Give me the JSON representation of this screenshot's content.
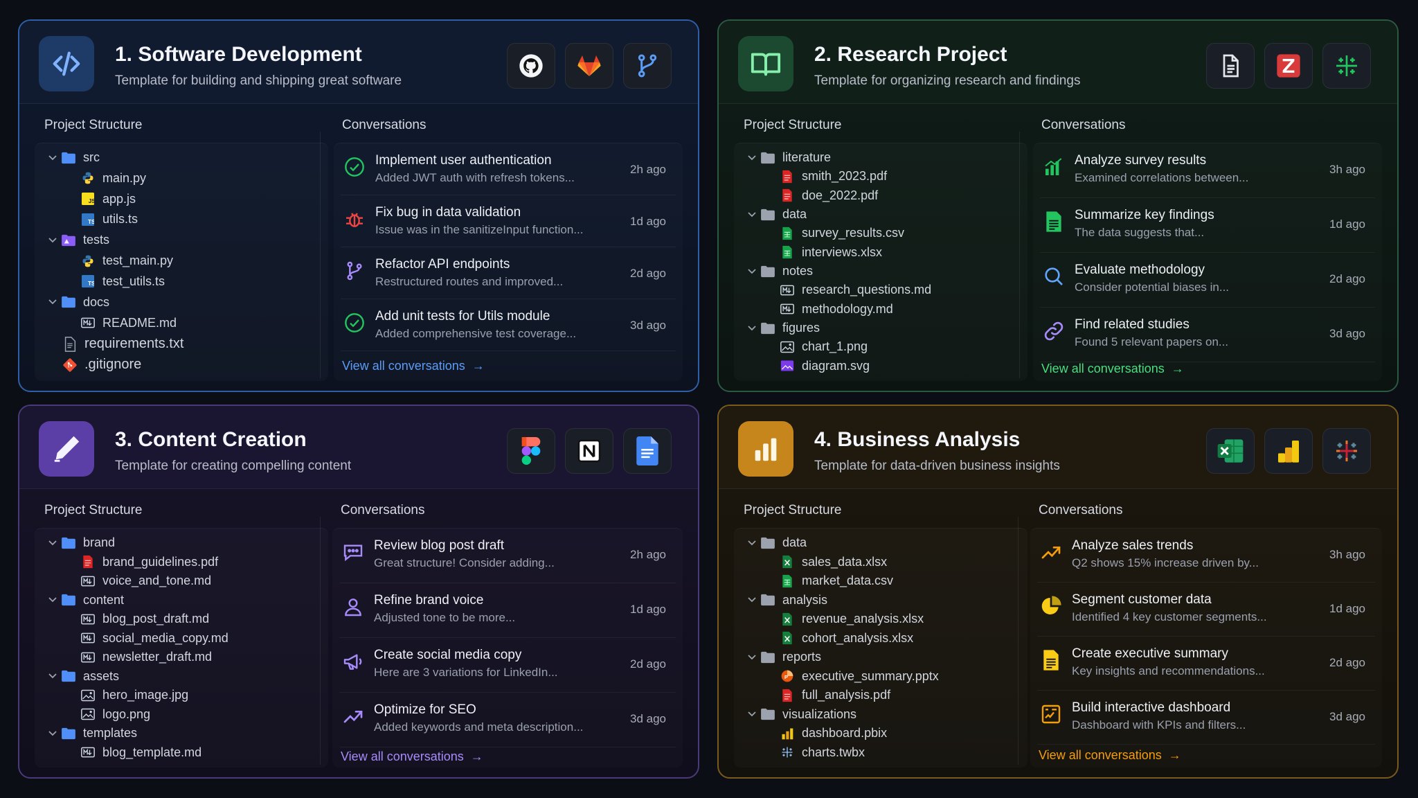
{
  "cards": [
    {
      "title": "1. Software Development",
      "subtitle": "Template for building and shipping great software",
      "accent": "#3b82f6",
      "tools": [
        "github-icon",
        "gitlab-icon",
        "git-branch-icon"
      ],
      "structure_label": "Project Structure",
      "conversations_label": "Conversations",
      "tree": [
        {
          "label": "src",
          "depth": 0,
          "type": "folder"
        },
        {
          "label": "main.py",
          "depth": 1,
          "type": "python"
        },
        {
          "label": "app.js",
          "depth": 1,
          "type": "js"
        },
        {
          "label": "utils.ts",
          "depth": 1,
          "type": "ts"
        },
        {
          "label": "tests",
          "depth": 0,
          "type": "test-folder"
        },
        {
          "label": "test_main.py",
          "depth": 1,
          "type": "python"
        },
        {
          "label": "test_utils.ts",
          "depth": 1,
          "type": "ts"
        },
        {
          "label": "docs",
          "depth": 0,
          "type": "folder"
        },
        {
          "label": "README.md",
          "depth": 1,
          "type": "md"
        },
        {
          "label": "requirements.txt",
          "depth": 0,
          "type": "txt"
        },
        {
          "label": ".gitignore",
          "depth": 0,
          "type": "git"
        }
      ],
      "conversations": [
        {
          "title": "Implement user authentication",
          "desc": "Added JWT auth with refresh tokens...",
          "ago": "2h ago",
          "icon": "check-circle-icon",
          "color": "#22c55e"
        },
        {
          "title": "Fix bug in data validation",
          "desc": "Issue was in the sanitizeInput function...",
          "ago": "1d ago",
          "icon": "bug-icon",
          "color": "#ef4444"
        },
        {
          "title": "Refactor API endpoints",
          "desc": "Restructured routes and improved...",
          "ago": "2d ago",
          "icon": "git-branch-icon",
          "color": "#a78bfa"
        },
        {
          "title": "Add unit tests for Utils module",
          "desc": "Added comprehensive test coverage...",
          "ago": "3d ago",
          "icon": "check-circle-icon",
          "color": "#22c55e"
        }
      ],
      "view_all": "View all conversations"
    },
    {
      "title": "2. Research Project",
      "subtitle": "Template for organizing research and findings",
      "accent": "#22c55e",
      "tools": [
        "document-icon",
        "zotero-icon",
        "grid-icon"
      ],
      "structure_label": "Project Structure",
      "conversations_label": "Conversations",
      "tree": [
        {
          "label": "literature",
          "depth": 0,
          "type": "folder-gray"
        },
        {
          "label": "smith_2023.pdf",
          "depth": 1,
          "type": "pdf"
        },
        {
          "label": "doe_2022.pdf",
          "depth": 1,
          "type": "pdf"
        },
        {
          "label": "data",
          "depth": 0,
          "type": "folder-gray"
        },
        {
          "label": "survey_results.csv",
          "depth": 1,
          "type": "csv"
        },
        {
          "label": "interviews.xlsx",
          "depth": 1,
          "type": "csv"
        },
        {
          "label": "notes",
          "depth": 0,
          "type": "folder-gray"
        },
        {
          "label": "research_questions.md",
          "depth": 1,
          "type": "md"
        },
        {
          "label": "methodology.md",
          "depth": 1,
          "type": "md"
        },
        {
          "label": "figures",
          "depth": 0,
          "type": "folder-gray"
        },
        {
          "label": "chart_1.png",
          "depth": 1,
          "type": "image"
        },
        {
          "label": "diagram.svg",
          "depth": 1,
          "type": "svg"
        }
      ],
      "conversations": [
        {
          "title": "Analyze survey results",
          "desc": "Examined correlations between...",
          "ago": "3h ago",
          "icon": "bar-chart-icon",
          "color": "#22c55e"
        },
        {
          "title": "Summarize key findings",
          "desc": "The data suggests that...",
          "ago": "1d ago",
          "icon": "document-icon",
          "color": "#22c55e"
        },
        {
          "title": "Evaluate methodology",
          "desc": "Consider potential biases in...",
          "ago": "2d ago",
          "icon": "search-icon",
          "color": "#60a5fa"
        },
        {
          "title": "Find related studies",
          "desc": "Found 5 relevant papers on...",
          "ago": "3d ago",
          "icon": "link-icon",
          "color": "#a78bfa"
        }
      ],
      "view_all": "View all conversations"
    },
    {
      "title": "3. Content Creation",
      "subtitle": "Template for creating compelling content",
      "accent": "#8b5cf6",
      "tools": [
        "figma-icon",
        "notion-icon",
        "google-docs-icon"
      ],
      "structure_label": "Project Structure",
      "conversations_label": "Conversations",
      "tree": [
        {
          "label": "brand",
          "depth": 0,
          "type": "folder"
        },
        {
          "label": "brand_guidelines.pdf",
          "depth": 1,
          "type": "pdf"
        },
        {
          "label": "voice_and_tone.md",
          "depth": 1,
          "type": "md"
        },
        {
          "label": "content",
          "depth": 0,
          "type": "folder"
        },
        {
          "label": "blog_post_draft.md",
          "depth": 1,
          "type": "md"
        },
        {
          "label": "social_media_copy.md",
          "depth": 1,
          "type": "md"
        },
        {
          "label": "newsletter_draft.md",
          "depth": 1,
          "type": "md"
        },
        {
          "label": "assets",
          "depth": 0,
          "type": "folder"
        },
        {
          "label": "hero_image.jpg",
          "depth": 1,
          "type": "image"
        },
        {
          "label": "logo.png",
          "depth": 1,
          "type": "image"
        },
        {
          "label": "templates",
          "depth": 0,
          "type": "folder"
        },
        {
          "label": "blog_template.md",
          "depth": 1,
          "type": "md"
        }
      ],
      "conversations": [
        {
          "title": "Review blog post draft",
          "desc": "Great structure! Consider adding...",
          "ago": "2h ago",
          "icon": "chat-bubble-icon",
          "color": "#a78bfa"
        },
        {
          "title": "Refine brand voice",
          "desc": "Adjusted tone to be more...",
          "ago": "1d ago",
          "icon": "user-icon",
          "color": "#a78bfa"
        },
        {
          "title": "Create social media copy",
          "desc": "Here are 3 variations for LinkedIn...",
          "ago": "2d ago",
          "icon": "megaphone-icon",
          "color": "#a78bfa"
        },
        {
          "title": "Optimize for SEO",
          "desc": "Added keywords and meta description...",
          "ago": "3d ago",
          "icon": "trend-up-icon",
          "color": "#a78bfa"
        }
      ],
      "view_all": "View all conversations"
    },
    {
      "title": "4. Business Analysis",
      "subtitle": "Template for data-driven business insights",
      "accent": "#f59e0b",
      "tools": [
        "excel-icon",
        "power-bi-icon",
        "tableau-icon"
      ],
      "structure_label": "Project Structure",
      "conversations_label": "Conversations",
      "tree": [
        {
          "label": "data",
          "depth": 0,
          "type": "folder-gray"
        },
        {
          "label": "sales_data.xlsx",
          "depth": 1,
          "type": "excel"
        },
        {
          "label": "market_data.csv",
          "depth": 1,
          "type": "csv"
        },
        {
          "label": "analysis",
          "depth": 0,
          "type": "folder-gray"
        },
        {
          "label": "revenue_analysis.xlsx",
          "depth": 1,
          "type": "excel"
        },
        {
          "label": "cohort_analysis.xlsx",
          "depth": 1,
          "type": "excel"
        },
        {
          "label": "reports",
          "depth": 0,
          "type": "folder-gray"
        },
        {
          "label": "executive_summary.pptx",
          "depth": 1,
          "type": "pptx"
        },
        {
          "label": "full_analysis.pdf",
          "depth": 1,
          "type": "pdf"
        },
        {
          "label": "visualizations",
          "depth": 0,
          "type": "folder-gray"
        },
        {
          "label": "dashboard.pbix",
          "depth": 1,
          "type": "pbix"
        },
        {
          "label": "charts.twbx",
          "depth": 1,
          "type": "twbx"
        }
      ],
      "conversations": [
        {
          "title": "Analyze sales trends",
          "desc": "Q2 shows 15% increase driven by...",
          "ago": "3h ago",
          "icon": "trend-up-icon",
          "color": "#f59e0b"
        },
        {
          "title": "Segment customer data",
          "desc": "Identified 4 key customer segments...",
          "ago": "1d ago",
          "icon": "pie-chart-icon",
          "color": "#facc15"
        },
        {
          "title": "Create executive summary",
          "desc": "Key insights and recommendations...",
          "ago": "2d ago",
          "icon": "document-icon",
          "color": "#facc15"
        },
        {
          "title": "Build interactive dashboard",
          "desc": "Dashboard with KPIs and filters...",
          "ago": "3d ago",
          "icon": "dashboard-icon",
          "color": "#f59e0b"
        }
      ],
      "view_all": "View all conversations"
    }
  ]
}
